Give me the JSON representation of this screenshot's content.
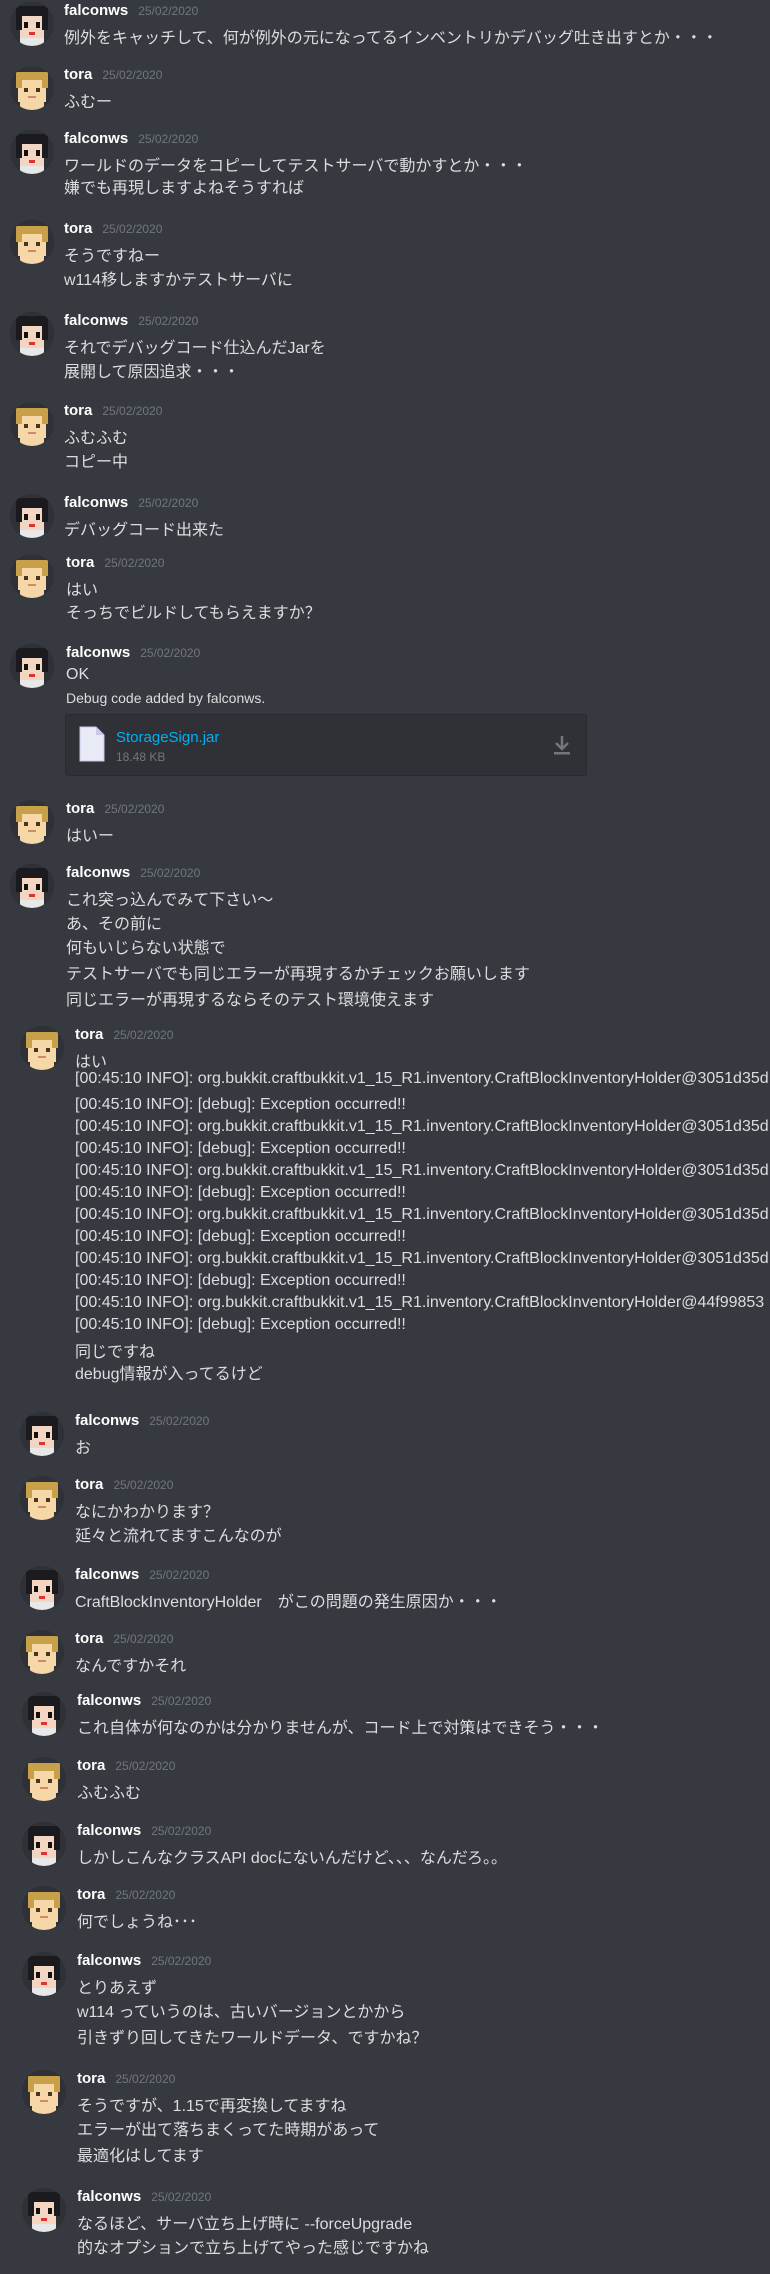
{
  "messages": [
    {
      "author": "falconws",
      "time": "25/02/2020",
      "lines": [
        "例外をキャッチして、何が例外の元になってるインベントリかデバッグ吐き出すとか・・・"
      ]
    },
    {
      "author": "tora",
      "time": "25/02/2020",
      "lines": [
        "ふむー"
      ]
    },
    {
      "author": "falconws",
      "time": "25/02/2020",
      "lines": [
        "ワールドのデータをコピーしてテストサーバで動かすとか・・・",
        "嫌でも再現しますよねそうすれば"
      ]
    },
    {
      "author": "tora",
      "time": "25/02/2020",
      "lines": [
        "そうですねー",
        "w114移しますかテストサーバに"
      ]
    },
    {
      "author": "falconws",
      "time": "25/02/2020",
      "lines": [
        "それでデバッグコード仕込んだJarを",
        "展開して原因追求・・・"
      ]
    },
    {
      "author": "tora",
      "time": "25/02/2020",
      "lines": [
        "ふむふむ",
        "コピー中"
      ]
    },
    {
      "author": "falconws",
      "time": "25/02/2020",
      "lines": [
        "デバッグコード出来た"
      ]
    },
    {
      "author": "tora",
      "time": "25/02/2020",
      "lines": [
        "はい",
        "そっちでビルドしてもらえますか？"
      ]
    },
    {
      "author": "falconws",
      "time": "25/02/2020",
      "lines": [
        "OK",
        "Debug code added by falconws."
      ]
    },
    {
      "author": "tora",
      "time": "25/02/2020",
      "lines": [
        "はいー"
      ]
    },
    {
      "author": "falconws",
      "time": "25/02/2020",
      "lines": [
        "これ突っ込んでみて下さい〜",
        "あ、その前に",
        "何もいじらない状態で",
        "テストサーバでも同じエラーが再現するかチェックお願いします",
        "同じエラーが再現するならそのテスト環境使えます"
      ]
    },
    {
      "author": "tora",
      "time": "25/02/2020",
      "lines": [
        "はい",
        "[00:45:10 INFO]: org.bukkit.craftbukkit.v1_15_R1.inventory.CraftBlockInventoryHolder@3051d35d",
        "[00:45:10 INFO]: [debug]: Exception occurred!!",
        "[00:45:10 INFO]: org.bukkit.craftbukkit.v1_15_R1.inventory.CraftBlockInventoryHolder@3051d35d",
        "[00:45:10 INFO]: [debug]: Exception occurred!!",
        "[00:45:10 INFO]: org.bukkit.craftbukkit.v1_15_R1.inventory.CraftBlockInventoryHolder@3051d35d",
        "[00:45:10 INFO]: [debug]: Exception occurred!!",
        "[00:45:10 INFO]: org.bukkit.craftbukkit.v1_15_R1.inventory.CraftBlockInventoryHolder@3051d35d",
        "[00:45:10 INFO]: [debug]: Exception occurred!!",
        "[00:45:10 INFO]: org.bukkit.craftbukkit.v1_15_R1.inventory.CraftBlockInventoryHolder@3051d35d",
        "[00:45:10 INFO]: [debug]: Exception occurred!!",
        "[00:45:10 INFO]: org.bukkit.craftbukkit.v1_15_R1.inventory.CraftBlockInventoryHolder@44f99853",
        "[00:45:10 INFO]: [debug]: Exception occurred!!",
        "同じですね",
        "debug情報が入ってるけど"
      ]
    },
    {
      "author": "falconws",
      "time": "25/02/2020",
      "lines": [
        "お"
      ]
    },
    {
      "author": "tora",
      "time": "25/02/2020",
      "lines": [
        "なにかわかります？",
        "延々と流れてますこんなのが"
      ]
    },
    {
      "author": "falconws",
      "time": "25/02/2020",
      "lines": [
        "CraftBlockInventoryHolder　がこの問題の発生原因か・・・"
      ]
    },
    {
      "author": "tora",
      "time": "25/02/2020",
      "lines": [
        "なんですかそれ"
      ]
    },
    {
      "author": "falconws",
      "time": "25/02/2020",
      "lines": [
        "これ自体が何なのかは分かりませんが、コード上で対策はできそう・・・"
      ]
    },
    {
      "author": "tora",
      "time": "25/02/2020",
      "lines": [
        "ふむふむ"
      ]
    },
    {
      "author": "falconws",
      "time": "25/02/2020",
      "lines": [
        "しかしこんなクラスAPI docにないんだけど、、、なんだろ。。"
      ]
    },
    {
      "author": "tora",
      "time": "25/02/2020",
      "lines": [
        "何でしょうね･･･"
      ]
    },
    {
      "author": "falconws",
      "time": "25/02/2020",
      "lines": [
        "とりあえず",
        "w114 っていうのは、古いバージョンとかから",
        "引きずり回してきたワールドデータ、ですかね？"
      ]
    },
    {
      "author": "tora",
      "time": "25/02/2020",
      "lines": [
        "そうですが、1.15で再変換してますね",
        "エラーが出て落ちまくってた時期があって",
        "最適化はしてます"
      ]
    },
    {
      "author": "falconws",
      "time": "25/02/2020",
      "lines": [
        "なるほど、サーバ立ち上げ時に --forceUpgrade",
        "的なオプションで立ち上げてやった感じですかね"
      ]
    }
  ],
  "attachment": {
    "file_name": "StorageSign.jar",
    "file_size": "18.48 KB",
    "file_icon": "file-icon",
    "download_icon": "download-icon"
  },
  "colors": {
    "background": "#36393f",
    "author": "#ffffff",
    "timestamp": "#72767d",
    "text": "#dcddde",
    "link": "#00b0f4"
  }
}
